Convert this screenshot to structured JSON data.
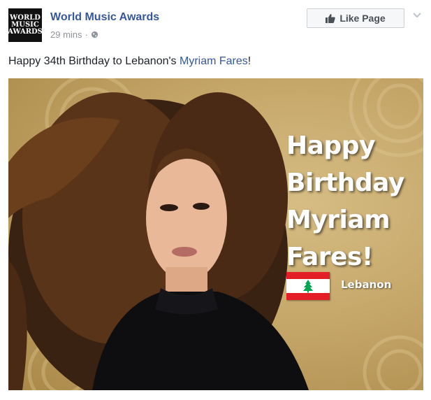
{
  "header": {
    "avatar_lines": [
      "WORLD",
      "MUSIC",
      "AWARDS"
    ],
    "page_name": "World Music Awards",
    "time": "29 mins",
    "separator": "·",
    "audience_icon": "globe-icon",
    "like_label": "Like Page",
    "like_icon": "thumbs-up-icon",
    "menu_icon": "chevron-down-icon"
  },
  "post": {
    "text_before": "Happy 34th Birthday to Lebanon's ",
    "mention": "Myriam Fares",
    "text_after": "!"
  },
  "image": {
    "headline_lines": [
      "Happy",
      "Birthday",
      "Myriam",
      "Fares!"
    ],
    "country": "Lebanon",
    "flag_icon": "lebanon-flag-icon"
  },
  "colors": {
    "link": "#365899",
    "meta": "#90949c",
    "text": "#1d2129",
    "flag_red": "#e41e26",
    "cedar_green": "#00a651"
  }
}
